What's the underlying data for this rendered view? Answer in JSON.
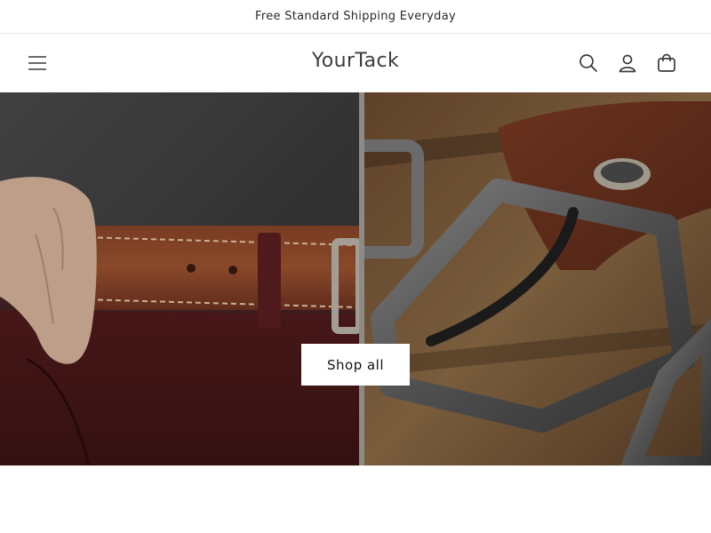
{
  "announcement": {
    "text": "Free Standard Shipping Everyday"
  },
  "header": {
    "logo": "YourTack",
    "icons": {
      "menu": "hamburger-menu-icon",
      "search": "search-icon",
      "account": "user-icon",
      "cart": "shopping-bag-icon"
    }
  },
  "hero": {
    "left_image": "man-wearing-brown-leather-belt-photo",
    "right_image": "belt-buckle-closeup-photo",
    "button_label": "Shop all"
  },
  "colors": {
    "text": "#121212",
    "border": "#e6e6e6",
    "button_bg": "#ffffff"
  }
}
